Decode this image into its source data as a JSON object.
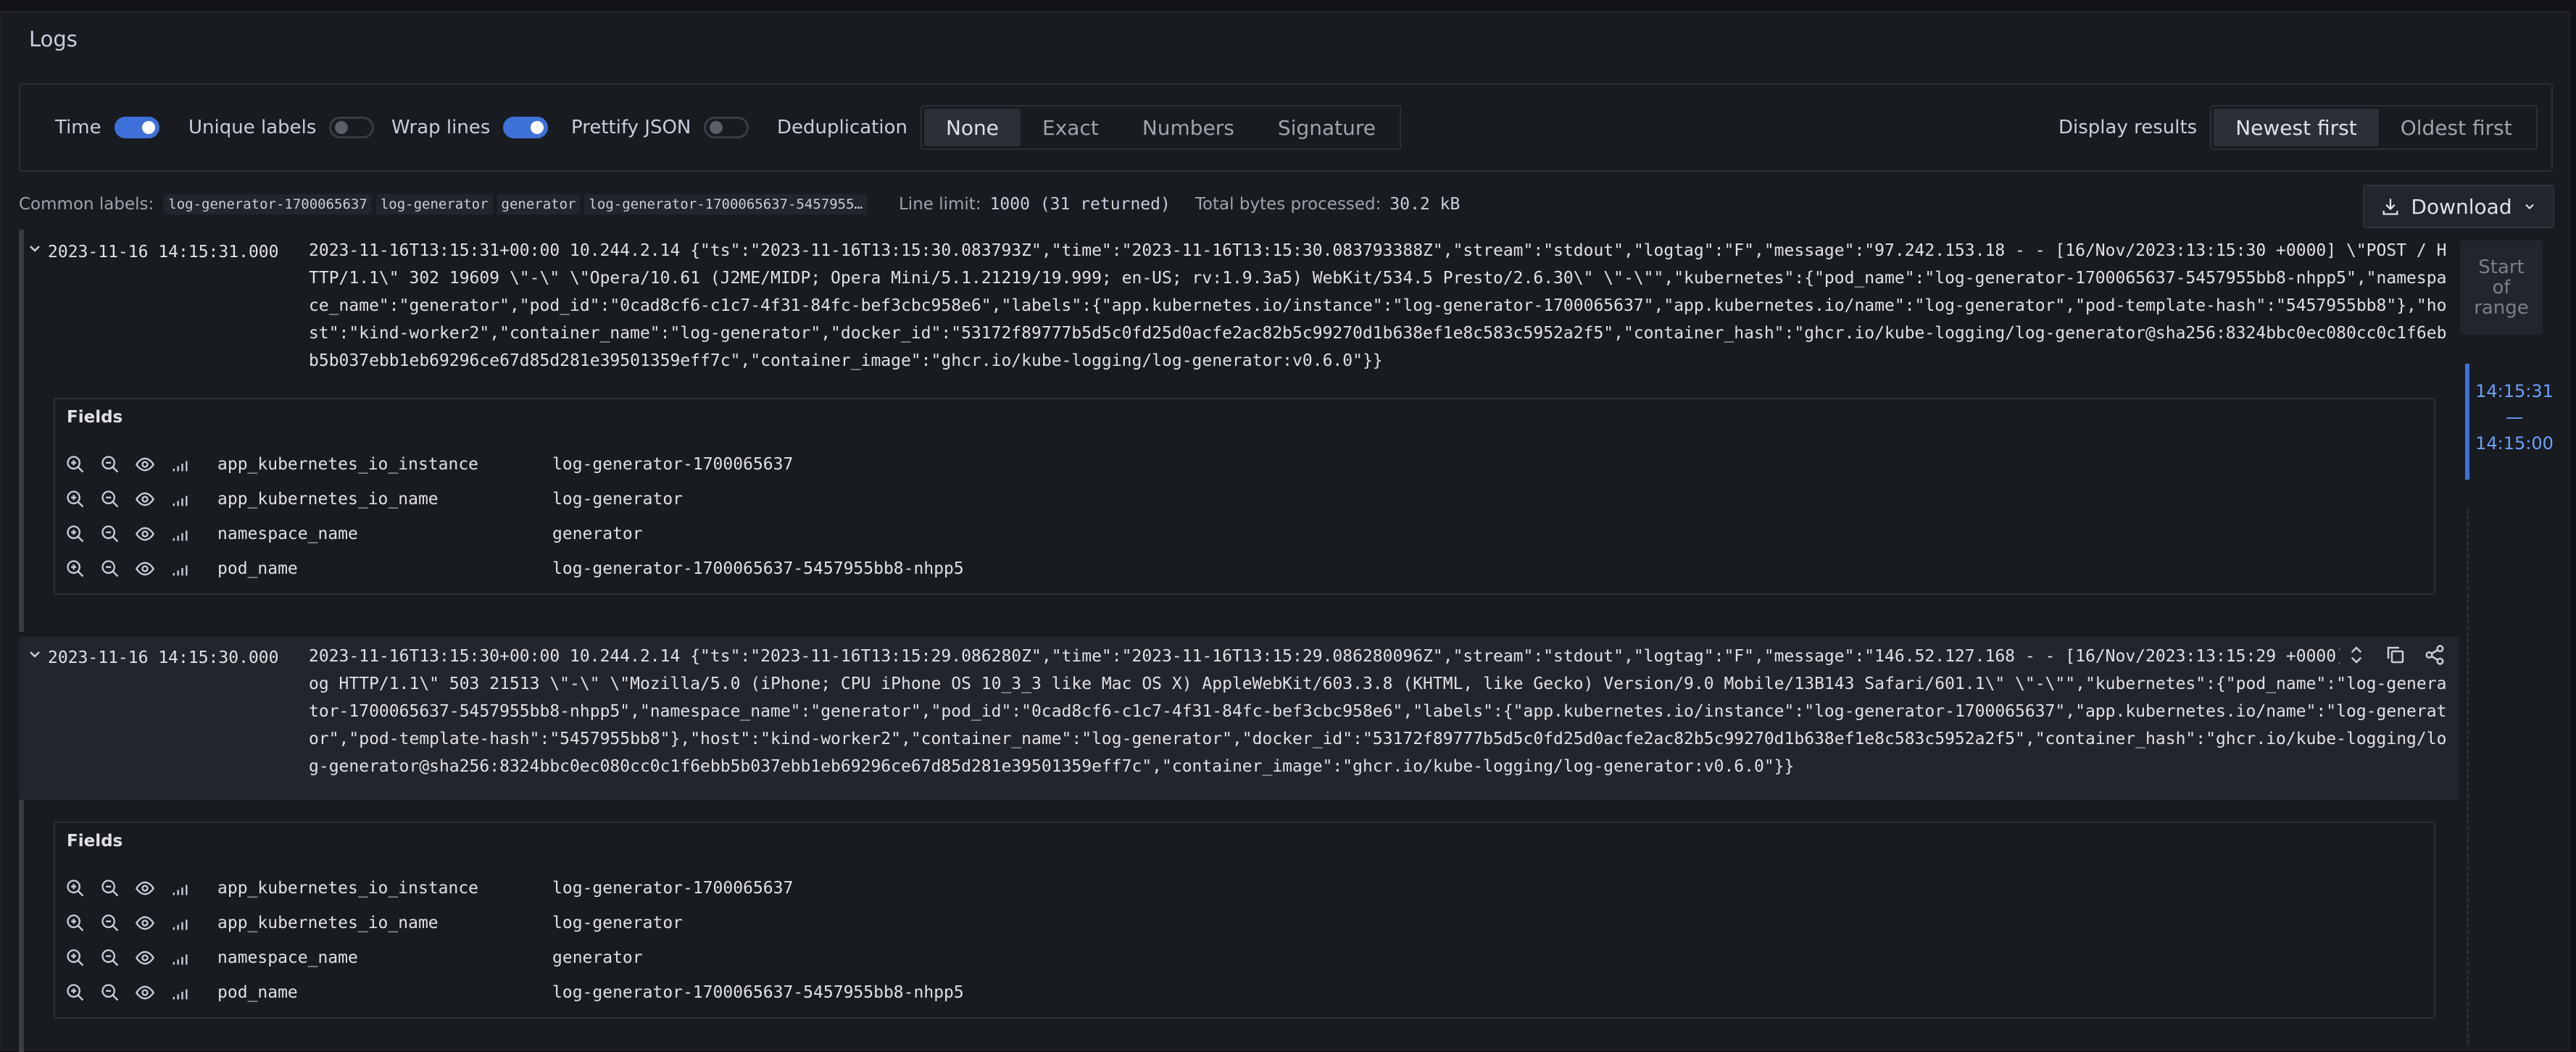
{
  "panel": {
    "title": "Logs"
  },
  "controls": {
    "time": {
      "label": "Time",
      "on": true
    },
    "unique_labels": {
      "label": "Unique labels",
      "on": false
    },
    "wrap_lines": {
      "label": "Wrap lines",
      "on": true
    },
    "prettify_json": {
      "label": "Prettify JSON",
      "on": false
    },
    "dedup": {
      "label": "Deduplication",
      "options": [
        "None",
        "Exact",
        "Numbers",
        "Signature"
      ],
      "selected": "None"
    },
    "display_results": {
      "label": "Display results",
      "options": [
        "Newest first",
        "Oldest first"
      ],
      "selected": "Newest first"
    }
  },
  "info": {
    "common_labels_label": "Common labels:",
    "common_labels": [
      "log-generator-1700065637",
      "log-generator",
      "generator",
      "log-generator-1700065637-5457955…"
    ],
    "line_limit_label": "Line limit:",
    "line_limit_value": "1000 (31 returned)",
    "bytes_label": "Total bytes processed:",
    "bytes_value": "30.2 kB"
  },
  "download": {
    "label": "Download",
    "icon": "download-icon"
  },
  "logs": [
    {
      "timestamp": "2023-11-16 14:15:31.000",
      "message": "2023-11-16T13:15:31+00:00 10.244.2.14 {\"ts\":\"2023-11-16T13:15:30.083793Z\",\"time\":\"2023-11-16T13:15:30.083793388Z\",\"stream\":\"stdout\",\"logtag\":\"F\",\"message\":\"97.242.153.18 - - [16/Nov/2023:13:15:30 +0000] \\\"POST / HTTP/1.1\\\" 302 19609 \\\"-\\\" \\\"Opera/10.61 (J2ME/MIDP; Opera Mini/5.1.21219/19.999; en-US; rv:1.9.3a5) WebKit/534.5 Presto/2.6.30\\\" \\\"-\\\"\",\"kubernetes\":{\"pod_name\":\"log-generator-1700065637-5457955bb8-nhpp5\",\"namespace_name\":\"generator\",\"pod_id\":\"0cad8cf6-c1c7-4f31-84fc-bef3cbc958e6\",\"labels\":{\"app.kubernetes.io/instance\":\"log-generator-1700065637\",\"app.kubernetes.io/name\":\"log-generator\",\"pod-template-hash\":\"5457955bb8\"},\"host\":\"kind-worker2\",\"container_name\":\"log-generator\",\"docker_id\":\"53172f89777b5d5c0fd25d0acfe2ac82b5c99270d1b638ef1e8c583c5952a2f5\",\"container_hash\":\"ghcr.io/kube-logging/log-generator@sha256:8324bbc0ec080cc0c1f6ebb5b037ebb1eb69296ce67d85d281e39501359eff7c\",\"container_image\":\"ghcr.io/kube-logging/log-generator:v0.6.0\"}}",
      "fields_title": "Fields",
      "fields": [
        {
          "key": "app_kubernetes_io_instance",
          "value": "log-generator-1700065637"
        },
        {
          "key": "app_kubernetes_io_name",
          "value": "log-generator"
        },
        {
          "key": "namespace_name",
          "value": "generator"
        },
        {
          "key": "pod_name",
          "value": "log-generator-1700065637-5457955bb8-nhpp5"
        }
      ]
    },
    {
      "timestamp": "2023-11-16 14:15:30.000",
      "message": "2023-11-16T13:15:30+00:00 10.244.2.14 {\"ts\":\"2023-11-16T13:15:29.086280Z\",\"time\":\"2023-11-16T13:15:29.086280096Z\",\"stream\":\"stdout\",\"logtag\":\"F\",\"message\":\"146.52.127.168 - - [16/Nov/2023:13:15:29 +0000] \\\"GET /blog HTTP/1.1\\\" 503 21513 \\\"-\\\" \\\"Mozilla/5.0 (iPhone; CPU iPhone OS 10_3_3 like Mac OS X) AppleWebKit/603.3.8 (KHTML, like Gecko) Version/9.0 Mobile/13B143 Safari/601.1\\\" \\\"-\\\"\",\"kubernetes\":{\"pod_name\":\"log-generator-1700065637-5457955bb8-nhpp5\",\"namespace_name\":\"generator\",\"pod_id\":\"0cad8cf6-c1c7-4f31-84fc-bef3cbc958e6\",\"labels\":{\"app.kubernetes.io/instance\":\"log-generator-1700065637\",\"app.kubernetes.io/name\":\"log-generator\",\"pod-template-hash\":\"5457955bb8\"},\"host\":\"kind-worker2\",\"container_name\":\"log-generator\",\"docker_id\":\"53172f89777b5d5c0fd25d0acfe2ac82b5c99270d1b638ef1e8c583c5952a2f5\",\"container_hash\":\"ghcr.io/kube-logging/log-generator@sha256:8324bbc0ec080cc0c1f6ebb5b037ebb1eb69296ce67d85d281e39501359eff7c\",\"container_image\":\"ghcr.io/kube-logging/log-generator:v0.6.0\"}}",
      "fields_title": "Fields",
      "fields": [
        {
          "key": "app_kubernetes_io_instance",
          "value": "log-generator-1700065637"
        },
        {
          "key": "app_kubernetes_io_name",
          "value": "log-generator"
        },
        {
          "key": "namespace_name",
          "value": "generator"
        },
        {
          "key": "pod_name",
          "value": "log-generator-1700065637-5457955bb8-nhpp5"
        }
      ]
    }
  ],
  "scroll": {
    "start_of_range": "Start of range",
    "range_from": "14:15:31",
    "range_sep": "—",
    "range_to": "14:15:00"
  },
  "colors": {
    "accent": "#3d71d9",
    "background": "#111217",
    "panel": "#181b1f"
  }
}
